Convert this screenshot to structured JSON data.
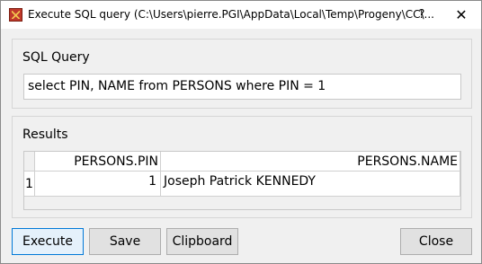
{
  "window": {
    "title": "Execute SQL query (C:\\Users\\pierre.PGI\\AppData\\Local\\Temp\\Progeny\\CC\\...",
    "help_label": "?",
    "close_label": "✕"
  },
  "query_group": {
    "label": "SQL Query",
    "query_value": "select PIN, NAME from PERSONS where PIN = 1"
  },
  "results_group": {
    "label": "Results",
    "columns": [
      "PERSONS.PIN",
      "PERSONS.NAME"
    ],
    "rows": [
      {
        "row_number": "1",
        "cells": [
          "1",
          "Joseph Patrick KENNEDY"
        ]
      }
    ]
  },
  "buttons": {
    "execute": "Execute",
    "save": "Save",
    "clipboard": "Clipboard",
    "close": "Close"
  },
  "colors": {
    "accent": "#0078d7",
    "window_bg": "#f0f0f0"
  }
}
